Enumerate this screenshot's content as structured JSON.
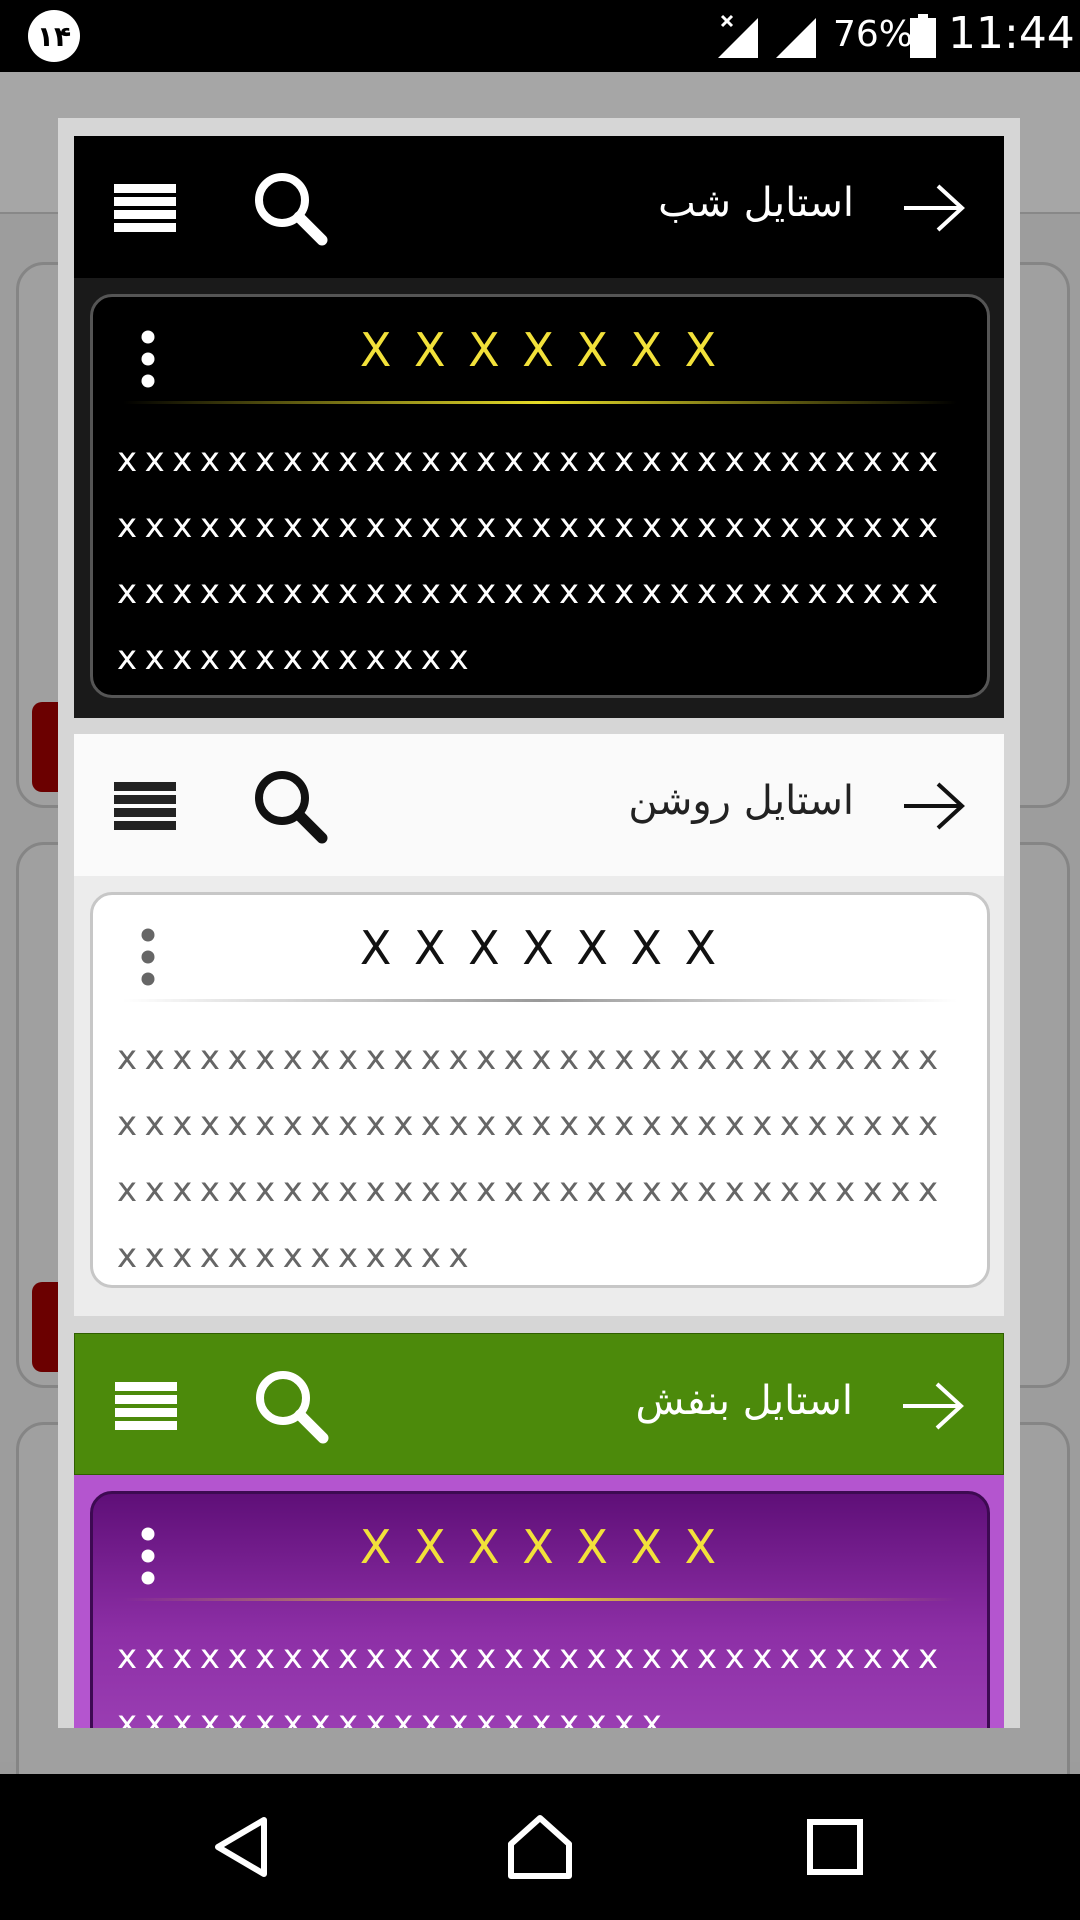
{
  "status_bar": {
    "notification_badge": "۱۴",
    "battery_percent": "76%",
    "time": "11:44"
  },
  "dialog": {
    "styles": [
      {
        "id": "night",
        "title": "استایل شب",
        "card_title": "X X X X X X X",
        "card_body": "xxxxxxxxxxxxxxxxxxxxxxxxxxxxxxxxxxxxxxxxxxxxxxxxxxxxxxxxxxxxxxxxxxxxxxxxxxxxxxxxxxxxxxxxxxxxxxxxxxxxxxx"
      },
      {
        "id": "light",
        "title": "استایل روشن",
        "card_title": "X X X X X X X",
        "card_body": "xxxxxxxxxxxxxxxxxxxxxxxxxxxxxxxxxxxxxxxxxxxxxxxxxxxxxxxxxxxxxxxxxxxxxxxxxxxxxxxxxxxxxxxxxxxxxxxxxxxxxxx"
      },
      {
        "id": "purple",
        "title": "استایل بنفش",
        "card_title": "X X X X X X X",
        "card_body": "xxxxxxxxxxxxxxxxxxxxxxxxxxxxxxxxxxxxxxxxxxxxxxxxxx"
      }
    ]
  },
  "icons": {
    "menu": "menu-icon",
    "search": "search-icon",
    "back": "arrow-icon",
    "overflow": "more-vertical-icon"
  },
  "colors": {
    "night_toolbar": "#000000",
    "night_title_accent": "#f2e13a",
    "light_toolbar": "#fafafa",
    "purple_toolbar": "#4c8a0b",
    "purple_card": "#8d2fa6"
  }
}
